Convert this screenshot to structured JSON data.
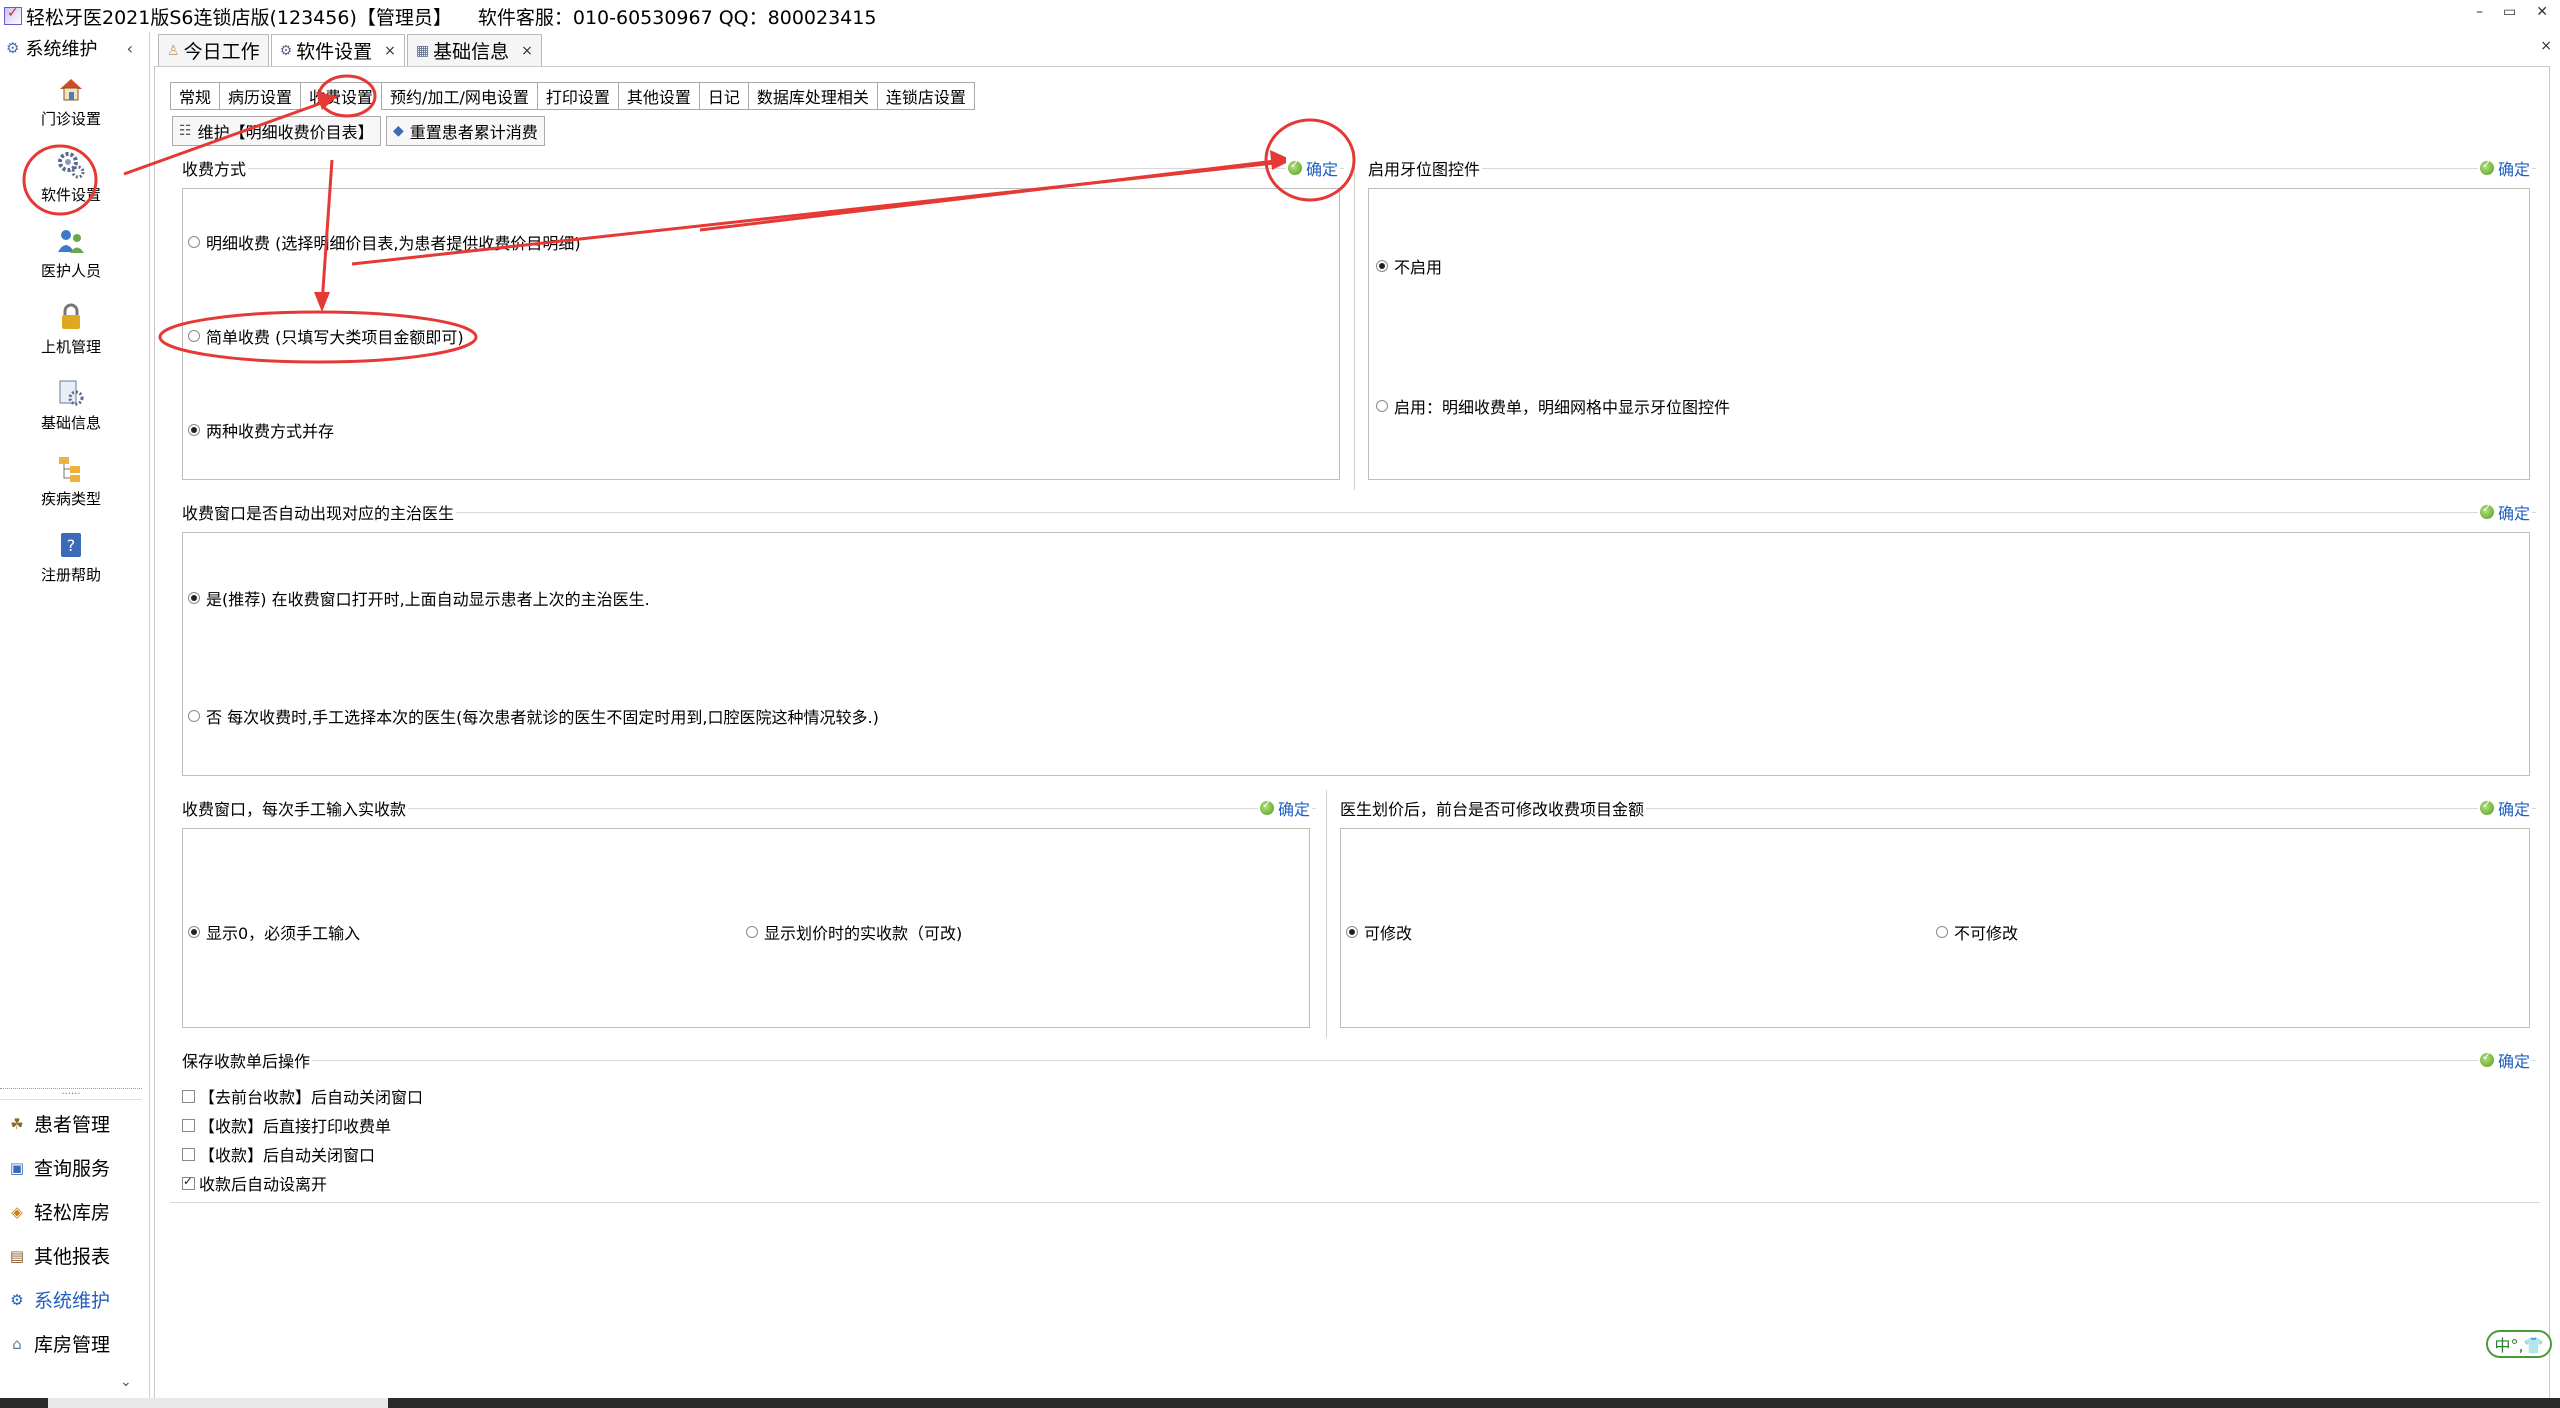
{
  "window": {
    "title": "轻松牙医2021版S6连锁店版(123456)【管理员】",
    "service": "软件客服：010-60530967 QQ：800023415",
    "minimize": "–",
    "restore": "▭",
    "close": "✕"
  },
  "sidebar": {
    "header": "系统维护",
    "collapse": "‹",
    "items": [
      {
        "label": "门诊设置",
        "icon": "house-icon"
      },
      {
        "label": "软件设置",
        "icon": "gears-icon"
      },
      {
        "label": "医护人员",
        "icon": "people-icon"
      },
      {
        "label": "上机管理",
        "icon": "lock-icon"
      },
      {
        "label": "基础信息",
        "icon": "gear-doc-icon"
      },
      {
        "label": "疾病类型",
        "icon": "tree-icon"
      },
      {
        "label": "注册帮助",
        "icon": "help-icon"
      }
    ],
    "divider": "......",
    "nav": [
      {
        "label": "患者管理"
      },
      {
        "label": "查询服务"
      },
      {
        "label": "轻松库房"
      },
      {
        "label": "其他报表"
      },
      {
        "label": "系统维护"
      },
      {
        "label": "库房管理"
      }
    ],
    "scroll_down": "⌄"
  },
  "doc_tabs": [
    {
      "label": "今日工作"
    },
    {
      "label": "软件设置",
      "close": "×"
    },
    {
      "label": "基础信息",
      "close": "×"
    }
  ],
  "doc_close": "×",
  "sub_tabs": [
    {
      "label": "常规"
    },
    {
      "label": "病历设置"
    },
    {
      "label": "收费设置"
    },
    {
      "label": "预约/加工/网电设置"
    },
    {
      "label": "打印设置"
    },
    {
      "label": "其他设置"
    },
    {
      "label": "日记"
    },
    {
      "label": "数据库处理相关"
    },
    {
      "label": "连锁店设置"
    }
  ],
  "toolbar": {
    "maintain": "维护【明细收费价目表】",
    "reset": "重置患者累计消费"
  },
  "ok_label": "确定",
  "panels": {
    "pay_mode": {
      "title": "收费方式",
      "options": [
        {
          "label": "明细收费 (选择明细价目表,为患者提供收费价目明细)",
          "selected": false
        },
        {
          "label": "简单收费 (只填写大类项目金额即可)",
          "selected": false
        },
        {
          "label": "两种收费方式并存",
          "selected": true
        }
      ]
    },
    "tooth_chart": {
      "title": "启用牙位图控件",
      "options": [
        {
          "label": "不启用",
          "selected": true
        },
        {
          "label": "启用：明细收费单，明细网格中显示牙位图控件",
          "selected": false
        }
      ]
    },
    "doctor": {
      "title": "收费窗口是否自动出现对应的主治医生",
      "options": [
        {
          "label": "是(推荐)    在收费窗口打开时,上面自动显示患者上次的主治医生.",
          "selected": true
        },
        {
          "label": "否     每次收费时,手工选择本次的医生(每次患者就诊的医生不固定时用到,口腔医院这种情况较多.)",
          "selected": false
        }
      ]
    },
    "manual_pay": {
      "title": "收费窗口，每次手工输入实收款",
      "options": [
        {
          "label": "显示0，必须手工输入",
          "selected": true
        },
        {
          "label": "显示划价时的实收款（可改)",
          "selected": false
        }
      ]
    },
    "edit_amount": {
      "title": "医生划价后，前台是否可修改收费项目金额",
      "options": [
        {
          "label": "可修改",
          "selected": true
        },
        {
          "label": "不可修改",
          "selected": false
        }
      ]
    },
    "after_save": {
      "title": "保存收款单后操作",
      "checks": [
        {
          "label": "【去前台收款】后自动关闭窗口",
          "checked": false
        },
        {
          "label": "【收款】后直接打印收费单",
          "checked": false
        },
        {
          "label": "【收款】后自动关闭窗口",
          "checked": false
        },
        {
          "label": "收款后自动设离开",
          "checked": true
        }
      ]
    }
  },
  "ime": "中°,👕",
  "colors": {
    "accent": "#1f5fbf",
    "annotation": "#e53935",
    "ok_green": "#4f9a1e"
  }
}
